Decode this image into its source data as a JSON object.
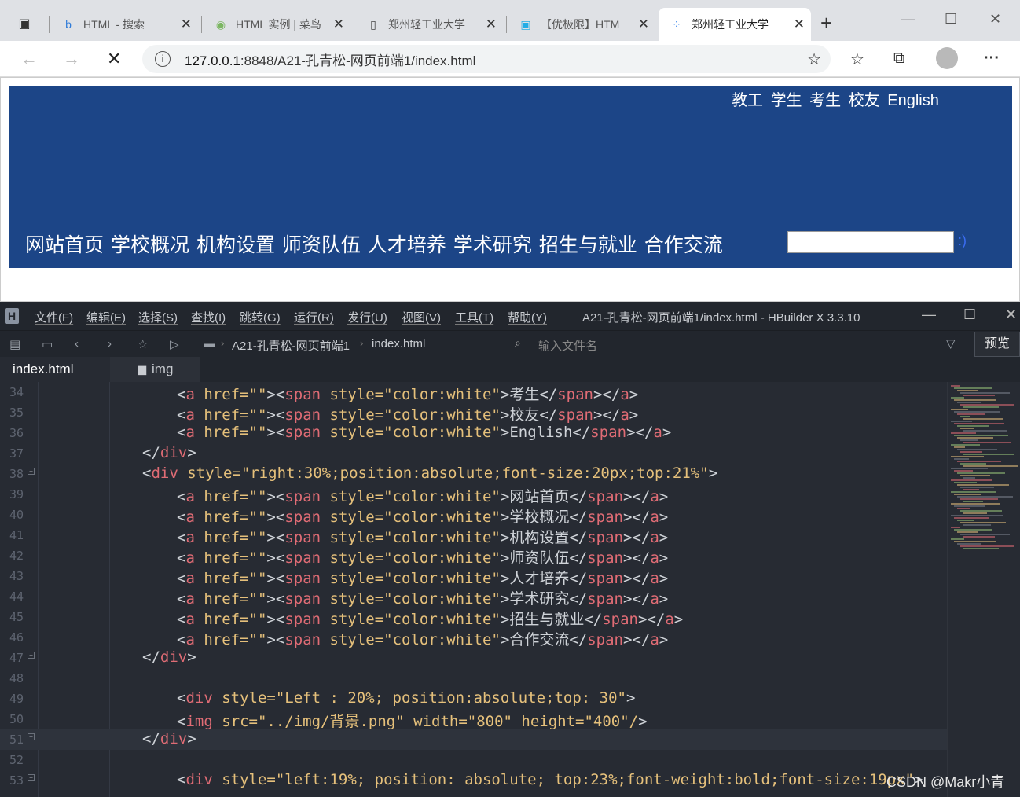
{
  "browser": {
    "tabs": [
      {
        "title": "HTML - 搜索",
        "icon": "bing-icon"
      },
      {
        "title": "HTML 实例 | 菜鸟",
        "icon": "runoob-icon"
      },
      {
        "title": "郑州轻工业大学",
        "icon": "page-icon"
      },
      {
        "title": "【优极限】HTM",
        "icon": "bilibili-icon"
      },
      {
        "title": "郑州轻工业大学",
        "icon": "loading-icon"
      }
    ],
    "new_tab": "+",
    "url_host": "127.0.0.1",
    "url_rest": ":8848/A21-孔青松-网页前端1/index.html"
  },
  "page": {
    "top_links": [
      "教工",
      "学生",
      "考生",
      "校友",
      "English"
    ],
    "nav_links": [
      "网站首页",
      "学校概况",
      "机构设置",
      "师资队伍",
      "人才培养",
      "学术研究",
      "招生与就业",
      "合作交流"
    ],
    "search_glyph": ":)",
    "banner_color": "#1c4587"
  },
  "ide": {
    "menu": [
      "文件(F)",
      "编辑(E)",
      "选择(S)",
      "查找(I)",
      "跳转(G)",
      "运行(R)",
      "发行(U)",
      "视图(V)",
      "工具(T)",
      "帮助(Y)"
    ],
    "title": "A21-孔青松-网页前端1/index.html - HBuilder X 3.3.10",
    "breadcrumb_project": "A21-孔青松-网页前端1",
    "breadcrumb_file": "index.html",
    "file_search_placeholder": "输入文件名",
    "preview_label": "预览",
    "file_tab": "index.html",
    "folder_tab": "img",
    "watermark": "CSDN @Makr小青",
    "lines": [
      {
        "n": "34",
        "indent": 2,
        "fold": false,
        "html": "<a href=\"\"><span style=\"color:white\">考生</span></a>"
      },
      {
        "n": "35",
        "indent": 2,
        "fold": false,
        "html": "<a href=\"\"><span style=\"color:white\">校友</span></a>"
      },
      {
        "n": "36",
        "indent": 2,
        "fold": false,
        "html": "<a href=\"\"><span style=\"color:white\">English</span></a>"
      },
      {
        "n": "37",
        "indent": 1,
        "fold": false,
        "html": "</div>"
      },
      {
        "n": "38",
        "indent": 1,
        "fold": true,
        "html": "<div style=\"right:30%;position:absolute;font-size:20px;top:21%\">"
      },
      {
        "n": "39",
        "indent": 2,
        "fold": false,
        "html": "<a href=\"\"><span style=\"color:white\">网站首页</span></a>"
      },
      {
        "n": "40",
        "indent": 2,
        "fold": false,
        "html": "<a href=\"\"><span style=\"color:white\">学校概况</span></a>"
      },
      {
        "n": "41",
        "indent": 2,
        "fold": false,
        "html": "<a href=\"\"><span style=\"color:white\">机构设置</span></a>"
      },
      {
        "n": "42",
        "indent": 2,
        "fold": false,
        "html": "<a href=\"\"><span style=\"color:white\">师资队伍</span></a>"
      },
      {
        "n": "43",
        "indent": 2,
        "fold": false,
        "html": "<a href=\"\"><span style=\"color:white\">人才培养</span></a>"
      },
      {
        "n": "44",
        "indent": 2,
        "fold": false,
        "html": "<a href=\"\"><span style=\"color:white\">学术研究</span></a>"
      },
      {
        "n": "45",
        "indent": 2,
        "fold": false,
        "html": "<a href=\"\"><span style=\"color:white\">招生与就业</span></a>"
      },
      {
        "n": "46",
        "indent": 2,
        "fold": false,
        "html": "<a href=\"\"><span style=\"color:white\">合作交流</span></a>"
      },
      {
        "n": "47",
        "indent": 1,
        "fold": true,
        "html": "</div>"
      },
      {
        "n": "48",
        "indent": 1,
        "fold": false,
        "html": ""
      },
      {
        "n": "49",
        "indent": 2,
        "fold": false,
        "html": "<div style=\"Left : 20%; position:absolute;top: 30\">"
      },
      {
        "n": "50",
        "indent": 2,
        "fold": false,
        "html": "<img src=\"../img/背景.png\" width=\"800\" height=\"400\"/>"
      },
      {
        "n": "51",
        "indent": 1,
        "fold": true,
        "html": "</div>"
      },
      {
        "n": "52",
        "indent": 1,
        "fold": false,
        "html": ""
      },
      {
        "n": "53",
        "indent": 2,
        "fold": true,
        "html": "<div style=\"left:19%; position: absolute; top:23%;font-weight:bold;font-size:19px\">"
      }
    ]
  }
}
